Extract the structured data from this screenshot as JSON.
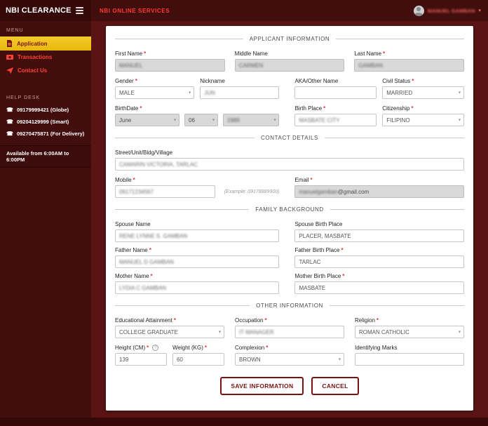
{
  "header": {
    "brand": "NBI CLEARANCE",
    "title": "NBI ONLINE SERVICES",
    "user_name": "MANUEL GAMBAN",
    "caret": "▾"
  },
  "sidebar": {
    "menu_label": "MENU",
    "items": [
      {
        "label": "Application"
      },
      {
        "label": "Transactions"
      },
      {
        "label": "Contact Us"
      }
    ],
    "helpdesk_label": "HELP DESK",
    "phone_icon": "☎",
    "phones": [
      {
        "number": "09179999421 (Globe)"
      },
      {
        "number": "09204129999 (Smart)"
      },
      {
        "number": "09270475871 (For Delivery)"
      }
    ],
    "availability": "Available from 6:00AM to 6:00PM"
  },
  "form": {
    "required_marker": "*",
    "chevron": "▾",
    "help_glyph": "?",
    "section_applicant": "APPLICANT INFORMATION",
    "first_name": {
      "label": "First Name",
      "value": "MANUEL"
    },
    "middle_name": {
      "label": "Middle Name",
      "value": "CARMEN"
    },
    "last_name": {
      "label": "Last Name",
      "value": "GAMBAN"
    },
    "gender": {
      "label": "Gender",
      "value": "MALE"
    },
    "nickname": {
      "label": "Nickname",
      "value": "JUN"
    },
    "aka": {
      "label": "AKA/Other Name",
      "value": ""
    },
    "civil_status": {
      "label": "Civil Status",
      "value": "MARRIED"
    },
    "birthdate": {
      "label": "BirthDate",
      "month": "June",
      "day": "06",
      "year": "1986"
    },
    "birth_place": {
      "label": "Birth Place",
      "value": "MASBATE CITY"
    },
    "citizenship": {
      "label": "Citizenship",
      "value": "FILIPINO"
    },
    "section_contact": "CONTACT DETAILS",
    "street": {
      "label": "Street/Unit/Bldg/Village",
      "value": "CAMARIN VICTORIA, TARLAC"
    },
    "mobile": {
      "label": "Mobile",
      "value": "09171234567",
      "example": "(Example: 09178889900)"
    },
    "email": {
      "label": "Email",
      "user": "manuelgamban",
      "domain": "@gmail.com"
    },
    "section_family": "FAMILY BACKGROUND",
    "spouse_name": {
      "label": "Spouse Name",
      "value": "RENE LYNNE S. GAMBAN"
    },
    "spouse_birth_place": {
      "label": "Spouse Birth Place",
      "value": "PLACER, MASBATE"
    },
    "father_name": {
      "label": "Father Name",
      "value": "MANUEL D GAMBAN"
    },
    "father_birth_place": {
      "label": "Father Birth Place",
      "value": "TARLAC"
    },
    "mother_name": {
      "label": "Mother Name",
      "value": "LYDIA C GAMBAN"
    },
    "mother_birth_place": {
      "label": "Mother Birth Place",
      "value": "MASBATE"
    },
    "section_other": "OTHER INFORMATION",
    "education": {
      "label": "Educational Attainment",
      "value": "COLLEGE GRADUATE"
    },
    "occupation": {
      "label": "Occupation",
      "value": "IT MANAGER"
    },
    "religion": {
      "label": "Religion",
      "value": "ROMAN CATHOLIC"
    },
    "height": {
      "label": "Height (CM)",
      "value": "139"
    },
    "weight": {
      "label": "Weight (KG)",
      "value": "60"
    },
    "complexion": {
      "label": "Complexion",
      "value": "BROWN"
    },
    "identifying_marks": {
      "label": "Identifying Marks",
      "value": ""
    },
    "save_label": "SAVE INFORMATION",
    "cancel_label": "CANCEL"
  }
}
